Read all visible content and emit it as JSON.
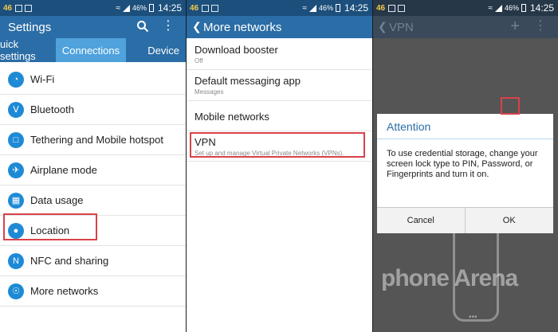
{
  "statusbar": {
    "network": "46",
    "battery": "46%",
    "time": "14:25"
  },
  "settings": {
    "title": "Settings",
    "tabs": {
      "quick": "uick settings",
      "connections": "Connections",
      "device": "Device"
    },
    "items": [
      {
        "label": "Wi-Fi",
        "icon": "wifi-icon"
      },
      {
        "label": "Bluetooth",
        "icon": "bluetooth-icon"
      },
      {
        "label": "Tethering and Mobile hotspot",
        "icon": "tethering-icon"
      },
      {
        "label": "Airplane mode",
        "icon": "airplane-icon"
      },
      {
        "label": "Data usage",
        "icon": "data-usage-icon"
      },
      {
        "label": "Location",
        "icon": "location-icon"
      },
      {
        "label": "NFC and sharing",
        "icon": "nfc-icon"
      },
      {
        "label": "More networks",
        "icon": "more-networks-icon"
      }
    ]
  },
  "more_networks": {
    "title": "More networks",
    "items": [
      {
        "label": "Download booster",
        "sub": "Off"
      },
      {
        "label": "Default messaging app",
        "sub": "Messages"
      },
      {
        "label": "Mobile networks",
        "sub": ""
      },
      {
        "label": "VPN",
        "sub": "Set up and manage Virtual Private Networks (VPNs)."
      }
    ]
  },
  "vpn": {
    "title": "VPN",
    "dialog": {
      "title": "Attention",
      "message": "To use credential storage, change your screen lock type to PIN, Password, or Fingerprints and turn it on.",
      "cancel": "Cancel",
      "ok": "OK"
    }
  },
  "watermark": "phone Arena",
  "colors": {
    "header": "#2b6da6",
    "active_tab": "#4fa2dc",
    "icon": "#1e8ad6",
    "highlight": "#d9424a"
  }
}
